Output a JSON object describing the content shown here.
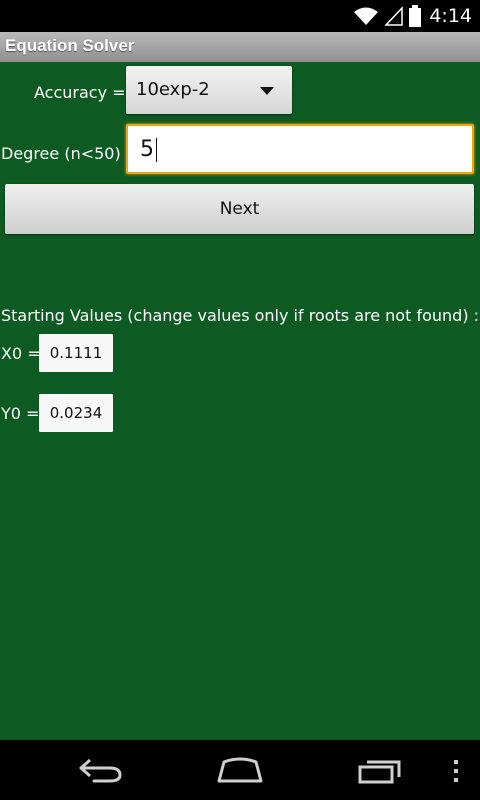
{
  "status_bar": {
    "time": "4:14",
    "icons": [
      "wifi-icon",
      "signal-icon",
      "battery-icon"
    ]
  },
  "app": {
    "title": "Equation Solver"
  },
  "form": {
    "accuracy_label": "Accuracy =",
    "accuracy_value": "10exp-2",
    "degree_label": "Degree (n<50) =",
    "degree_value": "5",
    "next_label": "Next"
  },
  "starting_values": {
    "heading": "Starting Values (change values only if roots are not found) :",
    "x0_label": "X0 =",
    "x0_value": "0.1111",
    "y0_label": "Y0 =",
    "y0_value": "0.0234"
  },
  "nav_bar": {
    "icons": [
      "back-icon",
      "home-icon",
      "recent-apps-icon",
      "overflow-menu-icon"
    ]
  },
  "colors": {
    "background": "#0d5a22",
    "focus_border": "#f0a418"
  }
}
